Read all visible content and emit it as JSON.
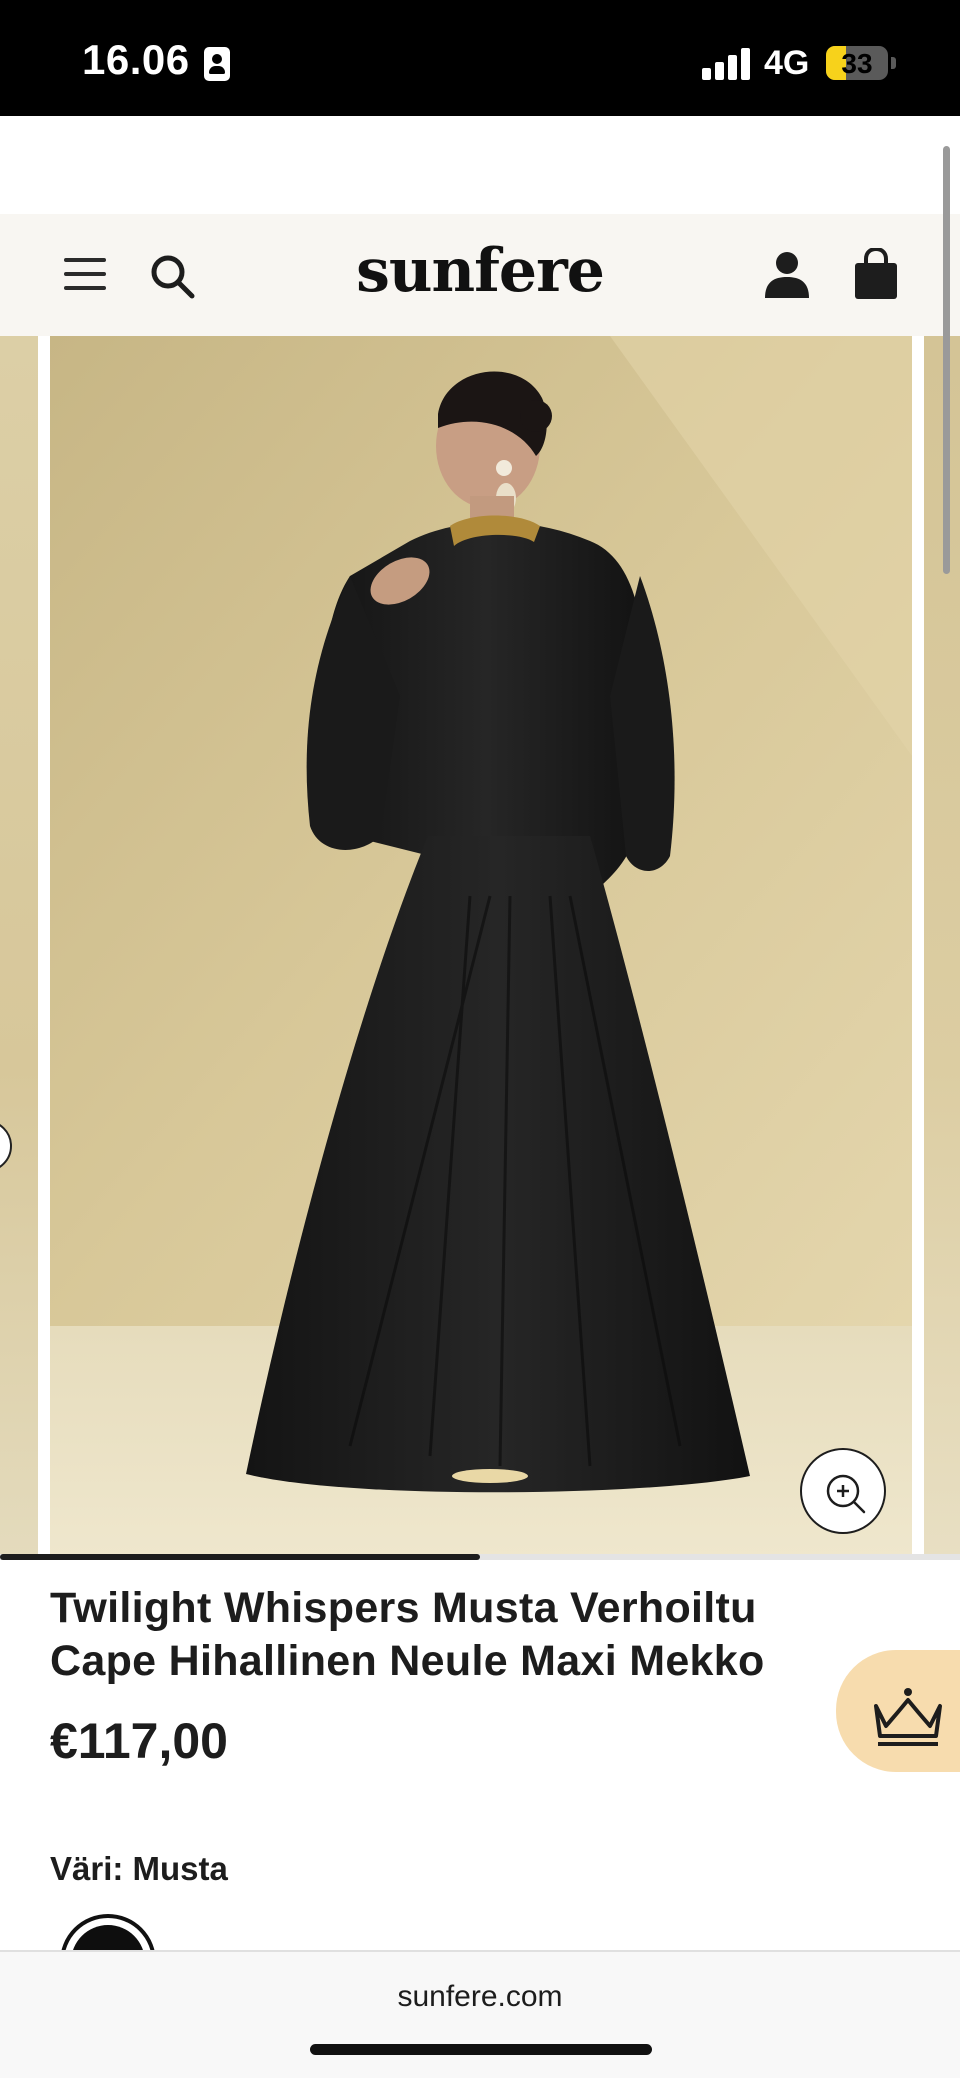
{
  "status_bar": {
    "time": "16.06",
    "network": "4G",
    "battery": "33",
    "battery_level": 0.33
  },
  "header": {
    "brand": "sunfere",
    "icons": [
      "menu-icon",
      "search-icon",
      "account-icon",
      "bag-icon"
    ]
  },
  "gallery": {
    "progress": 0.5,
    "icons": [
      "zoom-in-icon",
      "chevron-left-icon"
    ]
  },
  "product": {
    "title": "Twilight Whispers Musta Verhoiltu Cape Hihallinen Neule Maxi Mekko",
    "price": "€117,00",
    "color_label": "Väri: Musta",
    "swatch_color": "#0e0e0e"
  },
  "floating": {
    "icon": "crown-icon",
    "color": "#f7dcae"
  },
  "browser": {
    "url": "sunfere.com"
  }
}
